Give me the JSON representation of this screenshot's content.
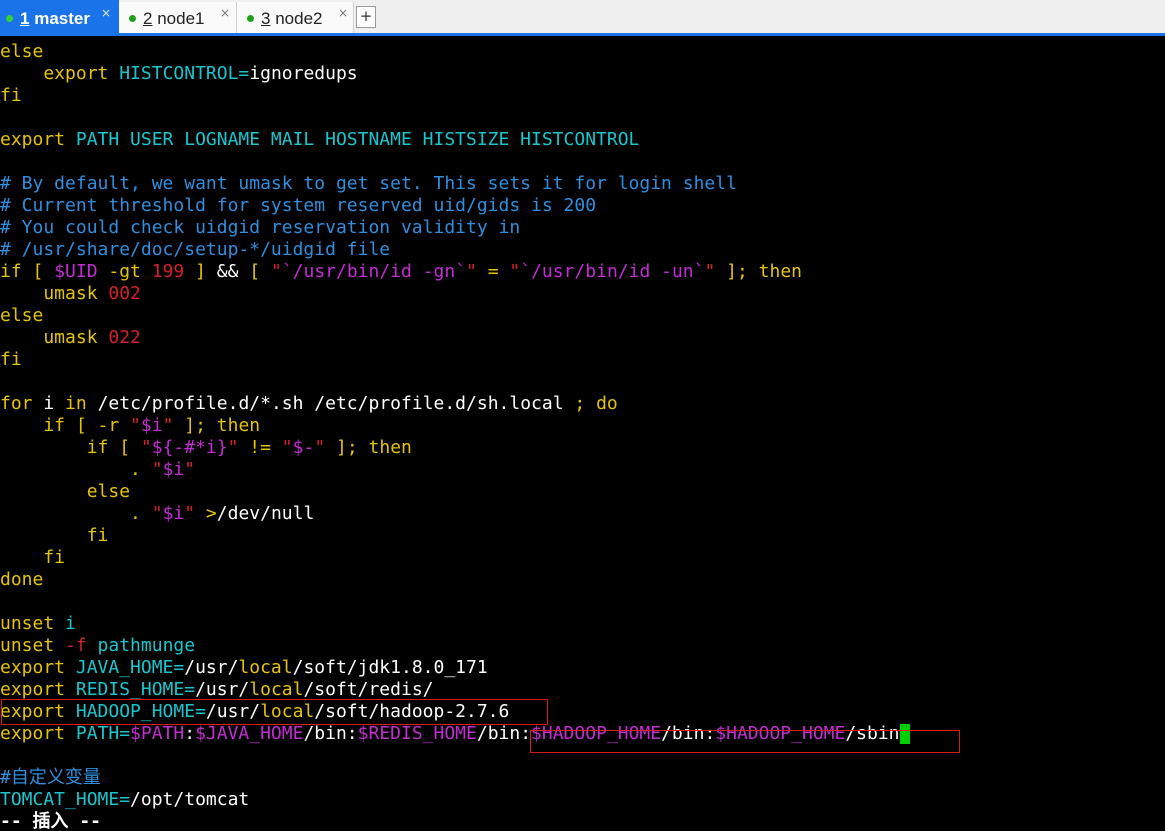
{
  "tabs": [
    {
      "num": "1",
      "name": "master",
      "close": "×"
    },
    {
      "num": "2",
      "name": "node1",
      "close": "×"
    },
    {
      "num": "3",
      "name": "node2",
      "close": "×"
    }
  ],
  "new_tab_label": "+",
  "terminal": {
    "lines": [
      [
        [
          "else",
          "y"
        ]
      ],
      [
        [
          "    export ",
          "y"
        ],
        [
          "HISTCONTROL=",
          "c"
        ],
        [
          "ignoredups",
          "w"
        ]
      ],
      [
        [
          "fi",
          "y"
        ]
      ],
      [],
      [
        [
          "export ",
          "y"
        ],
        [
          "PATH USER LOGNAME MAIL HOSTNAME HISTSIZE HISTCONTROL",
          "c"
        ]
      ],
      [],
      [
        [
          "# By default, we want umask to get set. This sets it for login shell",
          "b"
        ]
      ],
      [
        [
          "# Current threshold for system reserved uid/gids is 200",
          "b"
        ]
      ],
      [
        [
          "# You could check uidgid reservation validity in",
          "b"
        ]
      ],
      [
        [
          "# /usr/share/doc/setup-*/uidgid file",
          "b"
        ]
      ],
      [
        [
          "if [ ",
          "y"
        ],
        [
          "$UID",
          "m"
        ],
        [
          " -gt ",
          "y"
        ],
        [
          "199",
          "r"
        ],
        [
          " ] ",
          "y"
        ],
        [
          "&& ",
          "w"
        ],
        [
          "[ ",
          "y"
        ],
        [
          "\"",
          "r"
        ],
        [
          "`/usr/bin/id -gn`",
          "m"
        ],
        [
          "\"",
          "r"
        ],
        [
          " = ",
          "y"
        ],
        [
          "\"",
          "r"
        ],
        [
          "`/usr/bin/id -un`",
          "m"
        ],
        [
          "\"",
          "r"
        ],
        [
          " ]; then",
          "y"
        ]
      ],
      [
        [
          "    umask ",
          "y"
        ],
        [
          "002",
          "r"
        ]
      ],
      [
        [
          "else",
          "y"
        ]
      ],
      [
        [
          "    umask ",
          "y"
        ],
        [
          "022",
          "r"
        ]
      ],
      [
        [
          "fi",
          "y"
        ]
      ],
      [],
      [
        [
          "for ",
          "y"
        ],
        [
          "i ",
          "w"
        ],
        [
          "in ",
          "y"
        ],
        [
          "/etc/profile.d/*.sh /etc/profile.d/sh.local ",
          "w"
        ],
        [
          "; do",
          "y"
        ]
      ],
      [
        [
          "    if [ -r ",
          "y"
        ],
        [
          "\"",
          "r"
        ],
        [
          "$i",
          "m"
        ],
        [
          "\"",
          "r"
        ],
        [
          " ]; then",
          "y"
        ]
      ],
      [
        [
          "        if [ ",
          "y"
        ],
        [
          "\"",
          "r"
        ],
        [
          "${-#*i}",
          "m"
        ],
        [
          "\"",
          "r"
        ],
        [
          " != ",
          "y"
        ],
        [
          "\"",
          "r"
        ],
        [
          "$-",
          "m"
        ],
        [
          "\"",
          "r"
        ],
        [
          " ]; then",
          "y"
        ]
      ],
      [
        [
          "            . ",
          "y"
        ],
        [
          "\"",
          "r"
        ],
        [
          "$i",
          "m"
        ],
        [
          "\"",
          "r"
        ]
      ],
      [
        [
          "        else",
          "y"
        ]
      ],
      [
        [
          "            . ",
          "y"
        ],
        [
          "\"",
          "r"
        ],
        [
          "$i",
          "m"
        ],
        [
          "\"",
          "r"
        ],
        [
          " >",
          "y"
        ],
        [
          "/dev/null",
          "w"
        ]
      ],
      [
        [
          "        fi",
          "y"
        ]
      ],
      [
        [
          "    fi",
          "y"
        ]
      ],
      [
        [
          "done",
          "y"
        ]
      ],
      [],
      [
        [
          "unset ",
          "y"
        ],
        [
          "i",
          "c"
        ]
      ],
      [
        [
          "unset ",
          "y"
        ],
        [
          "-f ",
          "r"
        ],
        [
          "pathmunge",
          "c"
        ]
      ],
      [
        [
          "export ",
          "y"
        ],
        [
          "JAVA_HOME=",
          "c"
        ],
        [
          "/usr/",
          "w"
        ],
        [
          "local",
          "y"
        ],
        [
          "/soft/jdk1.8.0_171",
          "w"
        ]
      ],
      [
        [
          "export ",
          "y"
        ],
        [
          "REDIS_HOME=",
          "c"
        ],
        [
          "/usr/",
          "w"
        ],
        [
          "local",
          "y"
        ],
        [
          "/soft/redis/",
          "w"
        ]
      ],
      [
        [
          "export ",
          "y"
        ],
        [
          "HADOOP_HOME=",
          "c"
        ],
        [
          "/usr/",
          "w"
        ],
        [
          "local",
          "y"
        ],
        [
          "/soft/hadoop-2.7.6",
          "w"
        ]
      ],
      [
        [
          "export ",
          "y"
        ],
        [
          "PATH=",
          "c"
        ],
        [
          "$PATH",
          "m"
        ],
        [
          ":",
          "w"
        ],
        [
          "$JAVA_HOME",
          "m"
        ],
        [
          "/bin:",
          "w"
        ],
        [
          "$REDIS_HOME",
          "m"
        ],
        [
          "/bin:",
          "w"
        ],
        [
          "$HADOOP_HOME",
          "m"
        ],
        [
          "/bin:",
          "w"
        ],
        [
          "$HADOOP_HOME",
          "m"
        ],
        [
          "/sbin",
          "w"
        ]
      ],
      [],
      [
        [
          "#自定义变量",
          "b"
        ]
      ],
      [
        [
          "TOMCAT_HOME=",
          "c"
        ],
        [
          "/opt/tomcat",
          "w"
        ]
      ],
      [
        [
          "-- 插入 --",
          "w"
        ]
      ]
    ]
  },
  "colors": {
    "tab_active": "#1a73e8",
    "cursor": "#00d000",
    "highlight_box": "#d91b1b",
    "keyword": "#e6c500",
    "variable": "#17c7cf",
    "comment": "#2e8fe0",
    "string": "#d4202a",
    "special": "#c42bd4"
  }
}
